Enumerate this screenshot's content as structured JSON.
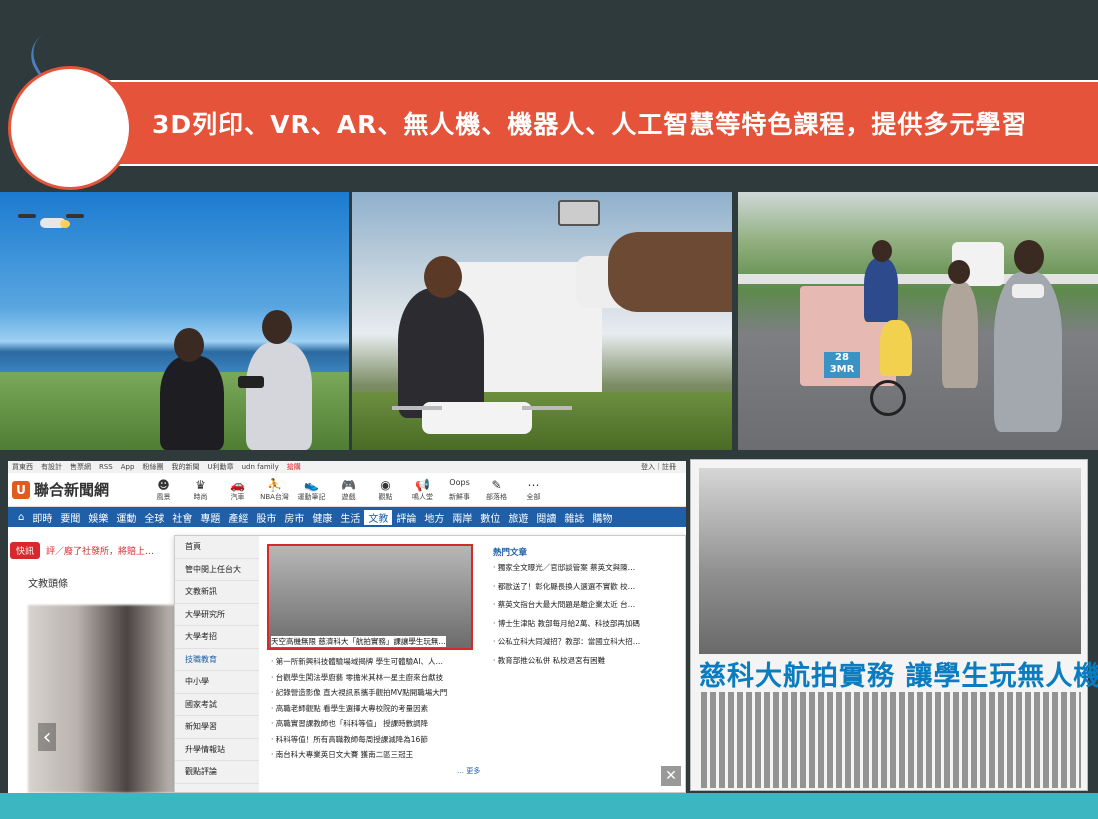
{
  "banner": {
    "title": "3D列印、VR、AR、無人機、機器人、人工智慧等特色課程，提供多元學習"
  },
  "photos": {
    "p3_sign": "28\n3MR"
  },
  "site": {
    "topstrip": [
      "買東西",
      "有設計",
      "售票網",
      "RSS",
      "App",
      "粉絲團",
      "我的新聞",
      "U利勳章",
      "udn family",
      "搶購"
    ],
    "topstrip_right": "登入｜註冊",
    "logo_letter": "U",
    "logo_text": "聯合新聞網",
    "categories": [
      {
        "icon": "☻",
        "label": "風景"
      },
      {
        "icon": "♛",
        "label": "時尚"
      },
      {
        "icon": "🚗",
        "label": "汽車"
      },
      {
        "icon": "⛹",
        "label": "NBA台灣"
      },
      {
        "icon": "👟",
        "label": "運動筆記"
      },
      {
        "icon": "🎮",
        "label": "遊戲"
      },
      {
        "icon": "◉",
        "label": "觀點"
      },
      {
        "icon": "📢",
        "label": "鳴人堂"
      },
      {
        "icon": "Oops",
        "label": "新鮮事"
      },
      {
        "icon": "✎",
        "label": "部落格"
      },
      {
        "icon": "⋯",
        "label": "全部"
      }
    ],
    "nav": [
      "即時",
      "要聞",
      "娛樂",
      "運動",
      "全球",
      "社會",
      "專題",
      "產經",
      "股市",
      "房市",
      "健康",
      "生活",
      "文教",
      "評論",
      "地方",
      "兩岸",
      "數位",
      "旅遊",
      "閱讀",
      "雜誌",
      "購物"
    ],
    "nav_active": "文教",
    "flash_tag": "快訊",
    "flash_text": "評／廢了社發所，將賠上…",
    "section_head": "文教頭條",
    "dropdown": {
      "menu": [
        "首頁",
        "管中閔上任台大",
        "文教新訊",
        "大學研究所",
        "大學考招",
        "技職教育",
        "中小學",
        "國家考試",
        "新知學習",
        "升學情報站",
        "觀點評論"
      ],
      "menu_active": "技職教育",
      "caption": "天空高機無限 慈濟科大「航拍實務」課讓學生玩無…",
      "list": [
        "第一所新興科技體驗場域揭牌 學生可體驗AI、人…",
        "台觀學生闖法學廚藝 零擔米其林一星主廚來台獻技",
        "記錄營造影像 直大視訊系攜手觀拍MV點開職場大門",
        "高職老師觀點 看學生選擇大專校院的考量因素",
        "高職實習課教師也「科科等值」 授課時數調降",
        "科科等值！所有高職教師每周授課減降為16節",
        "南台科大專業英日文大賽 獲南二區三冠王"
      ],
      "more": "… 更多",
      "hot_head": "熱門文章",
      "hot": [
        "獨家全文曝光／官邸談管案 蔡英文與陳…",
        "都歐送了！彰化縣長換人選選不實歡 校…",
        "蔡英文指台大最大問題是離企業太近 台…",
        "博士生津貼 教部每月給2萬、科技部再加碼",
        "公私立科大同減招？教部：當國立科大招…",
        "教育部推公私併 私校退宮有困難"
      ],
      "close": "✕"
    }
  },
  "paper": {
    "headline": "慈科大航拍實務  讓學生玩無人機"
  },
  "colors": {
    "banner": "#e5533a",
    "nav": "#1e5fa8",
    "headline": "#0a7cbf",
    "bottom": "#3cb6c1"
  }
}
